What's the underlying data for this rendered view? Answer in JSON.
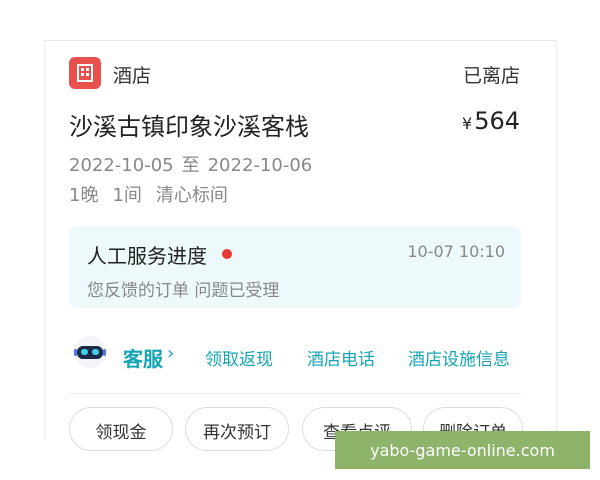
{
  "order": {
    "category_label": "酒店",
    "status": "已离店",
    "hotel_name": "沙溪古镇印象沙溪客栈",
    "price_symbol": "¥",
    "price_value": "564",
    "check_in": "2022-10-05",
    "date_separator": "至",
    "check_out": "2022-10-06",
    "nights": "1晚",
    "rooms": "1间",
    "room_type": "清心标间",
    "icon": "hotel-building-icon",
    "icon_color": "#e9504b"
  },
  "service_progress": {
    "title": "人工服务进度",
    "time": "10-07 10:10",
    "description": "您反馈的订单 问题已受理",
    "dot_color": "#e53935",
    "bg_color": "#edf9fa"
  },
  "service_links": {
    "customer_service": "客服",
    "chevron": "›",
    "links": [
      "领取返现",
      "酒店电话",
      "酒店设施信息"
    ],
    "accent_color": "#14a5b3"
  },
  "actions": {
    "buttons": [
      "领现金",
      "再次预订",
      "查看点评",
      "删除订单"
    ]
  },
  "watermark": {
    "text": "yabo-game-online.com",
    "bg_color": "#8eb36a"
  }
}
